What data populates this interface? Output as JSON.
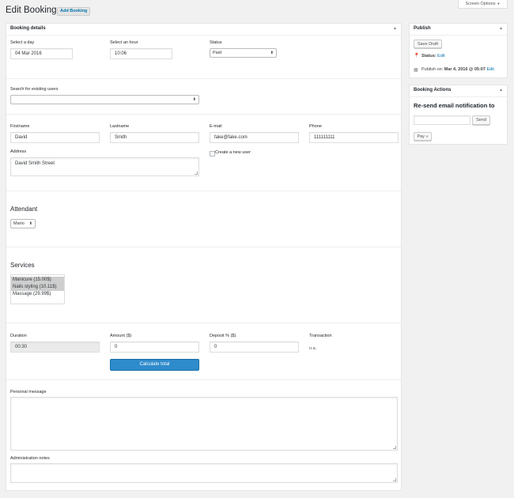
{
  "header": {
    "title": "Edit Booking",
    "add_button": "Add Booking",
    "screen_options": "Screen Options"
  },
  "booking": {
    "box_title": "Booking details",
    "day_label": "Select a day",
    "day_value": "04 Mar 2016",
    "hour_label": "Select an hour",
    "hour_value": "10:06",
    "status_label": "Status",
    "status_value": "Paid",
    "search_label": "Search for existing users",
    "search_value": "",
    "firstname_label": "Firstname",
    "firstname_value": "David",
    "lastname_label": "Lastname",
    "lastname_value": "Smith",
    "email_label": "E-mail",
    "email_value": "fake@fake.com",
    "phone_label": "Phone",
    "phone_value": "111111111",
    "address_label": "Address",
    "address_value": "David Smith Street",
    "create_user_label": "Create a new user",
    "create_user_checked": false,
    "attendant_heading": "Attendant",
    "attendant_value": "Mario",
    "services_heading": "Services",
    "services": [
      {
        "label": "Manicure (15.00$)",
        "selected": true
      },
      {
        "label": "Nails styling (10.11$)",
        "selected": true
      },
      {
        "label": "Massage (29.99$)",
        "selected": false
      }
    ],
    "duration_label": "Duration",
    "duration_value": "00:30",
    "amount_label": "Amount ($)",
    "amount_value": "0",
    "deposit_label": "Deposit % ($)",
    "deposit_value": "0",
    "transaction_label": "Transaction",
    "transaction_value": "n.a.",
    "calculate_button": "Calculate total",
    "personal_message_label": "Personal message",
    "personal_message_value": "",
    "admin_notes_label": "Administration notes",
    "admin_notes_value": ""
  },
  "publish": {
    "title": "Publish",
    "save_draft": "Save Draft",
    "status_label": "Status:",
    "status_edit": "Edit",
    "publish_on_prefix": "Publish on:",
    "publish_on_date": "Mar 4, 2016 @ 05:07",
    "publish_edit": "Edit"
  },
  "actions": {
    "title": "Booking Actions",
    "resend_heading": "Re-send email notification to",
    "resend_value": "",
    "send_button": "Send",
    "pay_button": "Pay »"
  },
  "colors": {
    "accent": "#0073aa",
    "primary_button": "#2e8bcc",
    "background": "#f1f1f1"
  }
}
